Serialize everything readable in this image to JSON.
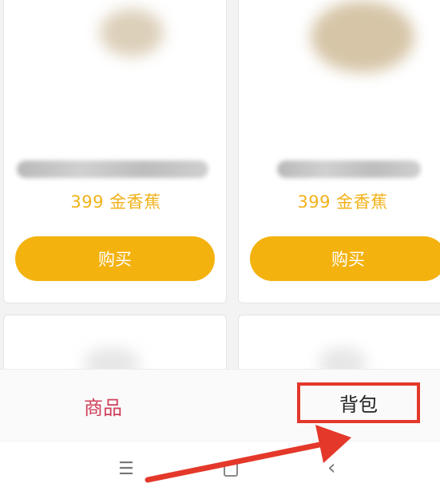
{
  "products": [
    {
      "price": "399 金香蕉",
      "buy_label": "购买"
    },
    {
      "price": "399 金香蕉",
      "buy_label": "购买"
    }
  ],
  "tabs": {
    "goods": "商品",
    "bag": "背包"
  },
  "nav": {
    "menu": "☰",
    "back": "‹"
  },
  "colors": {
    "accent_button": "#f4b20e",
    "price_text": "#f1b21a",
    "active_tab": "#d0405a",
    "highlight": "#e4382a"
  }
}
